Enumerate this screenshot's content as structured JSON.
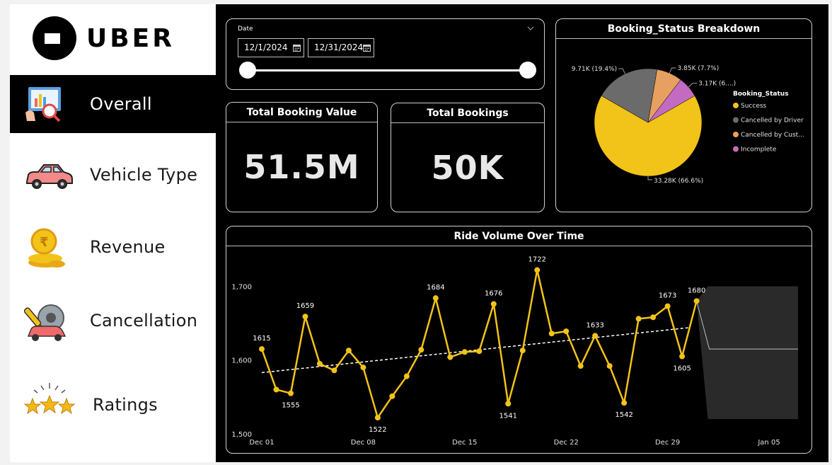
{
  "brand": {
    "name": "UBER"
  },
  "nav": {
    "items": [
      {
        "label": "Overall",
        "icon": "dashboard-magnifier-icon",
        "active": true
      },
      {
        "label": "Vehicle Type",
        "icon": "car-icon",
        "active": false
      },
      {
        "label": "Revenue",
        "icon": "rupee-coins-icon",
        "active": false
      },
      {
        "label": "Cancellation",
        "icon": "gear-wrench-car-icon",
        "active": false
      },
      {
        "label": "Ratings",
        "icon": "stars-icon",
        "active": false
      }
    ]
  },
  "date_filter": {
    "label": "Date",
    "start": "12/1/2024",
    "end": "12/31/2024",
    "range_selected": [
      0,
      1
    ]
  },
  "kpis": {
    "total_booking_value": {
      "title": "Total Booking Value",
      "value": "51.5M"
    },
    "total_bookings": {
      "title": "Total Bookings",
      "value": "50K"
    }
  },
  "colors": {
    "background": "#000000",
    "accent_yellow": "#f2c318",
    "success": "#f2c318",
    "cancelled_by_driver": "#6b6b6b",
    "cancelled_by_customer": "#e8a060",
    "incomplete": "#c36bc0"
  },
  "chart_data": [
    {
      "type": "pie",
      "title": "Booking_Status Breakdown",
      "legend_title": "Booking_Status",
      "legend_position": "right",
      "slices": [
        {
          "name": "Success",
          "legend_label": "Success",
          "value": 33280,
          "label": "33.28K (66.6%)",
          "color": "#f2c318"
        },
        {
          "name": "Cancelled by Driver",
          "legend_label": "Cancelled by Driver",
          "value": 9710,
          "label": "9.71K (19.4%)",
          "color": "#6b6b6b"
        },
        {
          "name": "Cancelled by Customer",
          "legend_label": "Cancelled by Cust...",
          "value": 3850,
          "label": "3.85K (7.7%)",
          "color": "#e8a060"
        },
        {
          "name": "Incomplete",
          "legend_label": "Incomplete",
          "value": 3170,
          "label": "3.17K (6....)",
          "color": "#c36bc0"
        }
      ]
    },
    {
      "type": "line",
      "title": "Ride Volume Over Time",
      "xlabel": "",
      "ylabel": "",
      "x": [
        "2024-12-01",
        "2024-12-02",
        "2024-12-03",
        "2024-12-04",
        "2024-12-05",
        "2024-12-06",
        "2024-12-07",
        "2024-12-08",
        "2024-12-09",
        "2024-12-10",
        "2024-12-11",
        "2024-12-12",
        "2024-12-13",
        "2024-12-14",
        "2024-12-15",
        "2024-12-16",
        "2024-12-17",
        "2024-12-18",
        "2024-12-19",
        "2024-12-20",
        "2024-12-21",
        "2024-12-22",
        "2024-12-23",
        "2024-12-24",
        "2024-12-25",
        "2024-12-26",
        "2024-12-27",
        "2024-12-28",
        "2024-12-29",
        "2024-12-30",
        "2024-12-31"
      ],
      "series": [
        {
          "values": [
            1615,
            1560,
            1555,
            1659,
            1595,
            1586,
            1613,
            1590,
            1522,
            1551,
            1578,
            1614,
            1684,
            1604,
            1611,
            1612,
            1676,
            1541,
            1613,
            1722,
            1636,
            1639,
            1592,
            1633,
            1592,
            1542,
            1656,
            1658,
            1673,
            1605,
            1680
          ]
        }
      ],
      "point_labels": [
        {
          "x": "2024-12-01",
          "text": "1615"
        },
        {
          "x": "2024-12-03",
          "text": "1555"
        },
        {
          "x": "2024-12-04",
          "text": "1659"
        },
        {
          "x": "2024-12-09",
          "text": "1522"
        },
        {
          "x": "2024-12-13",
          "text": "1684"
        },
        {
          "x": "2024-12-17",
          "text": "1676"
        },
        {
          "x": "2024-12-18",
          "text": "1541"
        },
        {
          "x": "2024-12-20",
          "text": "1722"
        },
        {
          "x": "2024-12-24",
          "text": "1633"
        },
        {
          "x": "2024-12-26",
          "text": "1542"
        },
        {
          "x": "2024-12-29",
          "text": "1673"
        },
        {
          "x": "2024-12-30",
          "text": "1605"
        },
        {
          "x": "2024-12-31",
          "text": "1680"
        }
      ],
      "trend_line": {
        "style": "dashed",
        "start_value": 1583,
        "end_value": 1644
      },
      "forecast": {
        "from": "2024-12-31",
        "to": "2025-01-07",
        "value": 1615,
        "upper": 1700,
        "lower": 1520
      },
      "x_ticks": [
        "Dec 01",
        "Dec 08",
        "Dec 15",
        "Dec 22",
        "Dec 29",
        "Jan 05"
      ],
      "x_tick_dates": [
        "2024-12-01",
        "2024-12-08",
        "2024-12-15",
        "2024-12-22",
        "2024-12-29",
        "2025-01-05"
      ],
      "x_range": [
        "2024-12-01",
        "2025-01-07"
      ],
      "y_ticks": [
        "1,500",
        "1,600",
        "1,700"
      ],
      "y_tick_values": [
        1500,
        1600,
        1700
      ],
      "ylim": [
        1500,
        1735
      ],
      "grid": false
    }
  ]
}
